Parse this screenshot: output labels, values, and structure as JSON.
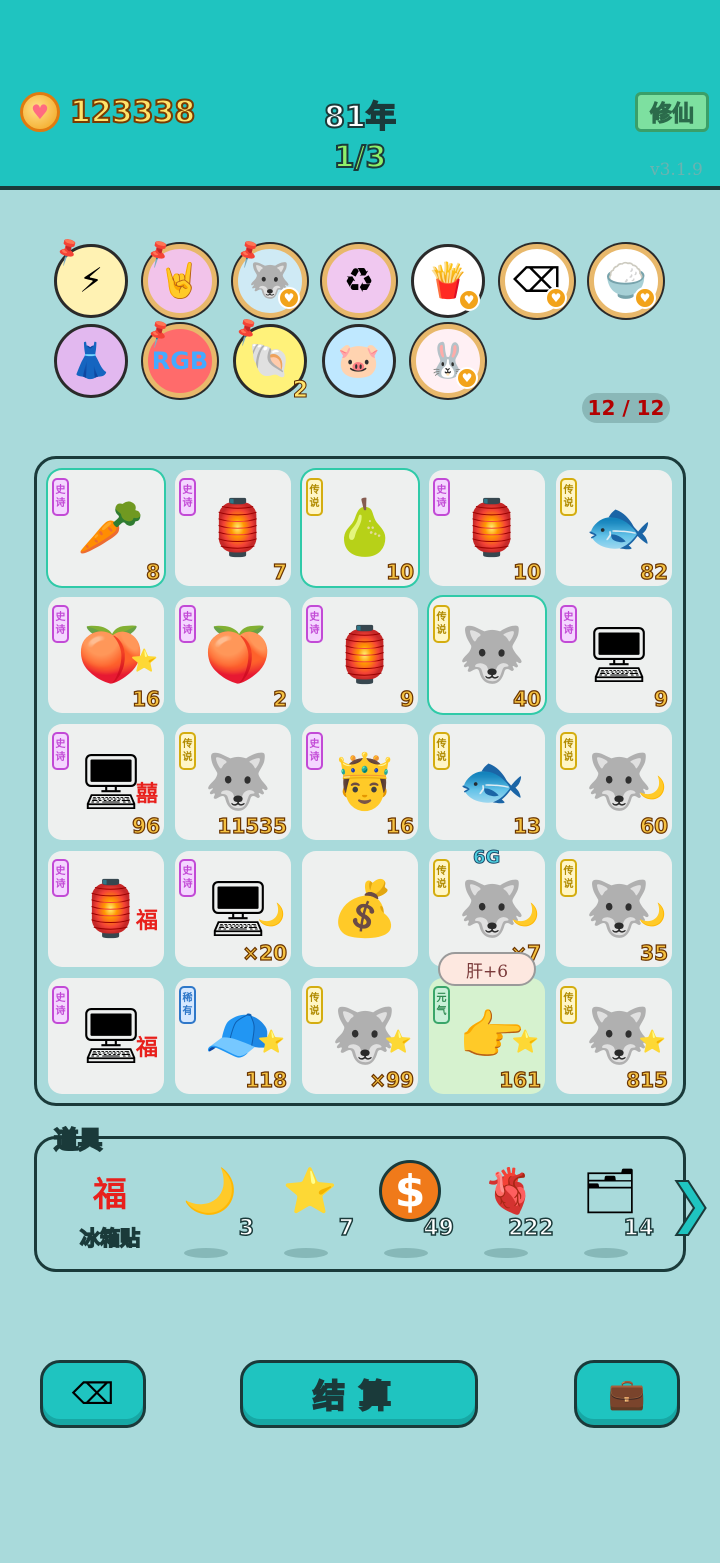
{
  "header": {
    "coins": "123338",
    "year": "81年",
    "progress": "1/3",
    "xiuxian_button": "修仙",
    "version": "v3.1.9"
  },
  "buffs": [
    {
      "icon": "lightning-icon",
      "glyph": "⚡",
      "bg": "#fff2b3"
    },
    {
      "icon": "rock-hand-icon",
      "glyph": "🤘",
      "bg": "#f2c3ea"
    },
    {
      "icon": "husky-icon",
      "glyph": "🐺",
      "bg": "#cfeaf5"
    },
    {
      "icon": "recycle-icon",
      "glyph": "♻",
      "bg": "#f0c8f0"
    },
    {
      "icon": "fries-icon",
      "glyph": "🍟",
      "bg": "#ffffff"
    },
    {
      "icon": "delete-tag-icon",
      "glyph": "⌫",
      "bg": "#ffffff"
    },
    {
      "icon": "rice-bowl-icon",
      "glyph": "🍚",
      "bg": "#ffffff"
    },
    {
      "icon": "skirt-icon",
      "glyph": "👗",
      "bg": "#e2b8ef"
    },
    {
      "icon": "rgb-icon",
      "glyph": "RGB",
      "bg": "#ff6b6b"
    },
    {
      "icon": "shell-icon",
      "glyph": "🐚",
      "bg": "#fff27a",
      "count": "2"
    },
    {
      "icon": "piggy-bank-icon",
      "glyph": "🐷",
      "bg": "#bfe8ff"
    },
    {
      "icon": "bunny-icon",
      "glyph": "🐰",
      "bg": "#fff0f4"
    }
  ],
  "capacity": "12 / 12",
  "cells": [
    {
      "tag": "史诗",
      "rarity": "epic",
      "icon": "carrot-icon",
      "glyph": "🥕",
      "count": "8",
      "glow": true
    },
    {
      "tag": "史诗",
      "rarity": "epic",
      "icon": "bunny-house-icon",
      "glyph": "🏮",
      "count": "7"
    },
    {
      "tag": "传说",
      "rarity": "legend",
      "icon": "pear-icon",
      "glyph": "🍐",
      "count": "10",
      "glow": true
    },
    {
      "tag": "史诗",
      "rarity": "epic",
      "icon": "bunny-house-icon",
      "glyph": "🏮",
      "count": "10"
    },
    {
      "tag": "传说",
      "rarity": "legend",
      "icon": "koi-fish-icon",
      "glyph": "🐟",
      "count": "82"
    },
    {
      "tag": "史诗",
      "rarity": "epic",
      "icon": "peach-icon",
      "glyph": "🍑",
      "count": "16",
      "sub": "⭐"
    },
    {
      "tag": "史诗",
      "rarity": "epic",
      "icon": "peach-icon",
      "glyph": "🍑",
      "count": "2"
    },
    {
      "tag": "史诗",
      "rarity": "epic",
      "icon": "bunny-house-icon",
      "glyph": "🏮",
      "count": "9"
    },
    {
      "tag": "传说",
      "rarity": "legend",
      "icon": "king-husky-icon",
      "glyph": "🐺",
      "count": "40",
      "glow": true
    },
    {
      "tag": "史诗",
      "rarity": "epic",
      "icon": "pc-case-icon",
      "glyph": "🖥",
      "count": "9"
    },
    {
      "tag": "史诗",
      "rarity": "epic",
      "icon": "pc-case-icon",
      "glyph": "🖥",
      "count": "96",
      "sub": "囍"
    },
    {
      "tag": "传说",
      "rarity": "legend",
      "icon": "king-husky-icon",
      "glyph": "🐺",
      "count": "11535"
    },
    {
      "tag": "史诗",
      "rarity": "epic",
      "icon": "king-face-icon",
      "glyph": "🤴",
      "count": "16"
    },
    {
      "tag": "传说",
      "rarity": "legend",
      "icon": "koi-fish-icon",
      "glyph": "🐟",
      "count": "13"
    },
    {
      "tag": "传说",
      "rarity": "legend",
      "icon": "king-husky-icon",
      "glyph": "🐺",
      "count": "60",
      "sub": "🌙"
    },
    {
      "tag": "史诗",
      "rarity": "epic",
      "icon": "bunny-house-icon",
      "glyph": "🏮",
      "count": "",
      "sub": "福"
    },
    {
      "tag": "史诗",
      "rarity": "epic",
      "icon": "pc-case-icon",
      "glyph": "🖥",
      "count": "×20",
      "sub": "🌙"
    },
    {
      "tag": "",
      "rarity": "none",
      "icon": "coin-pile-icon",
      "glyph": "💰",
      "count": ""
    },
    {
      "tag": "传说",
      "rarity": "legend",
      "icon": "king-husky-icon",
      "glyph": "🐺",
      "count": "×7",
      "sub": "🌙",
      "badge": "6G"
    },
    {
      "tag": "传说",
      "rarity": "legend",
      "icon": "king-husky-icon",
      "glyph": "🐺",
      "count": "35",
      "sub": "🌙"
    },
    {
      "tag": "史诗",
      "rarity": "epic",
      "icon": "pc-case-icon",
      "glyph": "🖥",
      "count": "",
      "sub": "福"
    },
    {
      "tag": "稀有",
      "rarity": "rare",
      "icon": "hat-guy-icon",
      "glyph": "🧢",
      "count": "118",
      "sub": "⭐"
    },
    {
      "tag": "传说",
      "rarity": "legend",
      "icon": "king-husky-icon",
      "glyph": "🐺",
      "count": "×99",
      "sub": "⭐"
    },
    {
      "tag": "元气",
      "rarity": "green",
      "icon": "pointing-hand-icon",
      "glyph": "👉",
      "count": "161",
      "sub": "⭐",
      "green": true
    },
    {
      "tag": "传说",
      "rarity": "legend",
      "icon": "king-husky-icon",
      "glyph": "🐺",
      "count": "815",
      "sub": "⭐"
    }
  ],
  "bubble": "肝+6",
  "props": {
    "title": "道具",
    "items": [
      {
        "icon": "fu-sticker-icon",
        "glyph": "福",
        "label": "冰箱贴",
        "count": ""
      },
      {
        "icon": "moon-icon",
        "glyph": "🌙",
        "label": "",
        "count": "3"
      },
      {
        "icon": "star-icon",
        "glyph": "⭐",
        "label": "",
        "count": "7"
      },
      {
        "icon": "dollar-coin-icon",
        "glyph": "$",
        "label": "",
        "count": "49"
      },
      {
        "icon": "liver-icon",
        "glyph": "🫀",
        "label": "",
        "count": "222"
      },
      {
        "icon": "epic-cards-icon",
        "glyph": "🗂",
        "label": "",
        "count": "14"
      }
    ]
  },
  "bottom": {
    "settle": "结算"
  }
}
